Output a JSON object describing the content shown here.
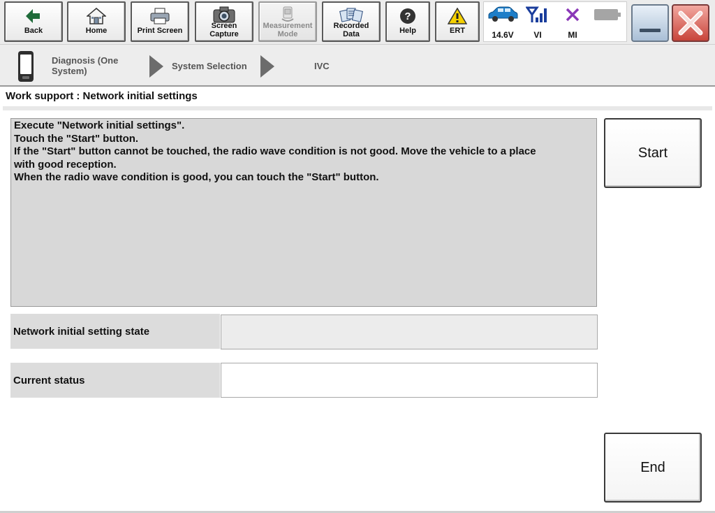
{
  "toolbar": {
    "back": "Back",
    "home": "Home",
    "print_screen": "Print Screen",
    "screen_capture_1": "Screen",
    "screen_capture_2": "Capture",
    "measurement_1": "Measurement",
    "measurement_2": "Mode",
    "recorded_1": "Recorded",
    "recorded_2": "Data",
    "help": "Help",
    "ert": "ERT"
  },
  "status": {
    "voltage": "14.6V",
    "vi": "VI",
    "mi": "MI"
  },
  "breadcrumb": {
    "step1_line1": "Diagnosis (One",
    "step1_line2": "System)",
    "step2": "System Selection",
    "step3": "IVC"
  },
  "page": {
    "title": "Work support : Network initial settings"
  },
  "message": {
    "lines": [
      "Execute \"Network initial settings\".",
      "Touch the \"Start\" button.",
      "If the \"Start\" button cannot be touched, the radio wave condition is not good. Move the vehicle to a place",
      "with good reception.",
      "When the radio wave condition is good, you can touch the \"Start\" button."
    ]
  },
  "fields": {
    "network_state_label": "Network initial setting state",
    "network_state_value": "",
    "current_status_label": "Current status",
    "current_status_value": ""
  },
  "buttons": {
    "start": "Start",
    "end": "End"
  },
  "colors": {
    "toolbar_bg": "#ececec",
    "message_bg": "#d8d8d8",
    "signal_blue": "#1a3d9c",
    "mi_purple": "#8a38b8",
    "warning_yellow": "#f5d000",
    "close_red": "#c8443a"
  },
  "icons": [
    "back-arrow-icon",
    "home-icon",
    "printer-icon",
    "camera-icon",
    "measurement-icon",
    "recorded-data-icon",
    "help-icon",
    "warning-icon",
    "car-icon",
    "signal-icon",
    "mi-x-icon",
    "battery-icon",
    "minimize-icon",
    "close-icon",
    "handheld-device-icon"
  ]
}
